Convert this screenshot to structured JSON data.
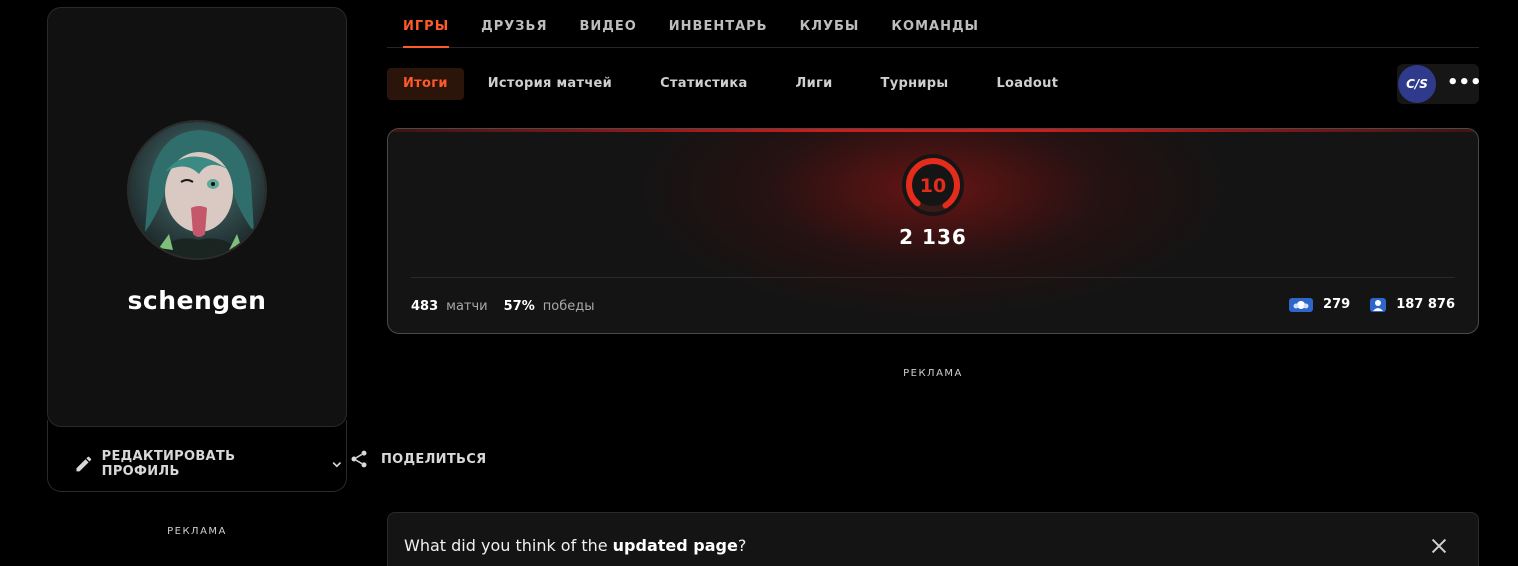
{
  "profile": {
    "username": "schengen",
    "edit_label": "РЕДАКТИРОВАТЬ ПРОФИЛЬ",
    "share_label": "ПОДЕЛИТЬСЯ",
    "ad_label": "РЕКЛАМА"
  },
  "top_tabs": [
    {
      "label": "ИГРЫ",
      "active": true
    },
    {
      "label": "ДРУЗЬЯ",
      "active": false
    },
    {
      "label": "ВИДЕО",
      "active": false
    },
    {
      "label": "ИНВЕНТАРЬ",
      "active": false
    },
    {
      "label": "КЛУБЫ",
      "active": false
    },
    {
      "label": "КОМАНДЫ",
      "active": false
    }
  ],
  "sub_tabs": [
    {
      "label": "Итоги",
      "active": true
    },
    {
      "label": "История матчей",
      "active": false
    },
    {
      "label": "Статистика",
      "active": false
    },
    {
      "label": "Лиги",
      "active": false
    },
    {
      "label": "Турниры",
      "active": false
    },
    {
      "label": "Loadout",
      "active": false
    }
  ],
  "game_switch": {
    "logo_text": "C/S",
    "more_label": "•••"
  },
  "level_card": {
    "level": "10",
    "level_progress": 0.8,
    "elo": "2 136",
    "matches_value": "483",
    "matches_label": "матчи",
    "wins_value": "57%",
    "wins_label": "победы",
    "stat_a": "279",
    "stat_b": "187 876"
  },
  "ad_center": "РЕКЛАМА",
  "feedback": {
    "prefix": "What did you think of the ",
    "highlight": "updated page",
    "suffix": "?"
  },
  "colors": {
    "accent": "#ff5a2a",
    "level_red": "#e32c1c",
    "chip_blue": "#2f66c9"
  },
  "icons": [
    "pencil-icon",
    "chevron-down-icon",
    "share-icon",
    "close-icon",
    "level-gauge-icon"
  ]
}
